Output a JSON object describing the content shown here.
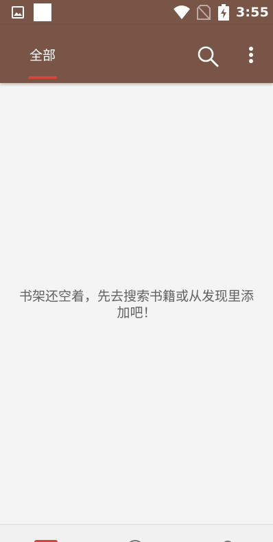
{
  "status_bar": {
    "time": "3:55",
    "icons": [
      "gallery-icon",
      "notification-square-icon",
      "wifi-icon",
      "no-sim-icon",
      "battery-charging-icon"
    ]
  },
  "app_bar": {
    "tabs": [
      {
        "label": "全部",
        "selected": true
      }
    ],
    "actions": [
      "search-icon",
      "more-vert-icon"
    ]
  },
  "main": {
    "empty_message": "书架还空着，先去搜索书籍或从发现里添加吧！"
  },
  "bottom_nav": {
    "items": [
      {
        "icon": "bookshelf-icon",
        "selected": true
      },
      {
        "icon": "discover-icon",
        "selected": false
      },
      {
        "icon": "profile-icon",
        "selected": false
      }
    ]
  },
  "colors": {
    "primary": "#795548",
    "accent": "#d6453c",
    "background": "#f4f4f4",
    "message_text": "#616161"
  }
}
